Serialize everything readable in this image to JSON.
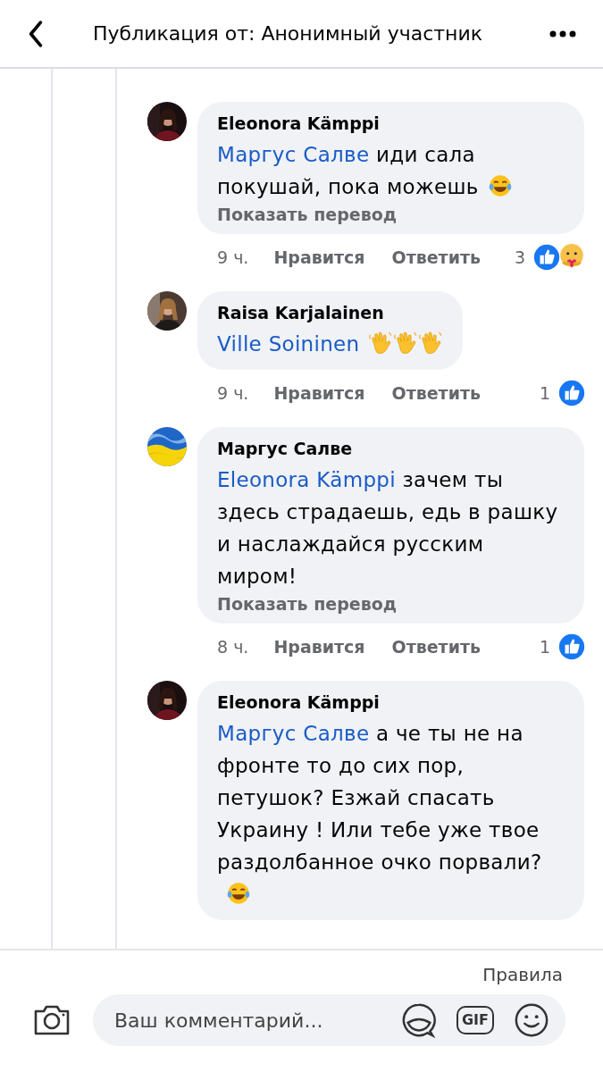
{
  "header": {
    "title": "Публикация от: Анонимный участник"
  },
  "comments": [
    {
      "author": "Eleonora Kämppi",
      "segments": [
        {
          "kind": "mention",
          "text": "Маргус Салве"
        },
        {
          "kind": "text",
          "text": " иди сала покушай, пока можешь"
        },
        {
          "kind": "laughing"
        }
      ],
      "translate": "Показать перевод",
      "time": "9 ч.",
      "like": "Нравится",
      "reply": "Ответить",
      "count": "3",
      "reactions": [
        {
          "kind": "like"
        },
        {
          "kind": "care"
        }
      ]
    },
    {
      "author": "Raisa Karjalainen",
      "segments": [
        {
          "kind": "mention",
          "text": "Ville Soininen"
        },
        {
          "kind": "waving"
        },
        {
          "kind": "waving"
        },
        {
          "kind": "waving"
        }
      ],
      "time": "9 ч.",
      "like": "Нравится",
      "reply": "Ответить",
      "count": "1",
      "reactions": [
        {
          "kind": "like"
        }
      ]
    },
    {
      "author": "Маргус Салве",
      "segments": [
        {
          "kind": "mention",
          "text": "Eleonora Kämppi"
        },
        {
          "kind": "text",
          "text": " зачем ты здесь страдаешь, едь в рашку и наслаждайся русским миром!"
        }
      ],
      "translate": "Показать перевод",
      "time": "8 ч.",
      "like": "Нравится",
      "reply": "Ответить",
      "count": "1",
      "reactions": [
        {
          "kind": "like"
        }
      ]
    },
    {
      "author": "Eleonora Kämppi",
      "segments": [
        {
          "kind": "mention",
          "text": "Маргус Салве"
        },
        {
          "kind": "text",
          "text": " а че ты не на фронте то до сих пор, петушок? Езжай спасать Украину ! Или тебе уже твое раздолбанное очко порвали? "
        },
        {
          "kind": "laughing"
        }
      ]
    }
  ],
  "footer": {
    "rules": "Правила",
    "placeholder": "Ваш комментарий...",
    "gif_label": "GIF"
  }
}
